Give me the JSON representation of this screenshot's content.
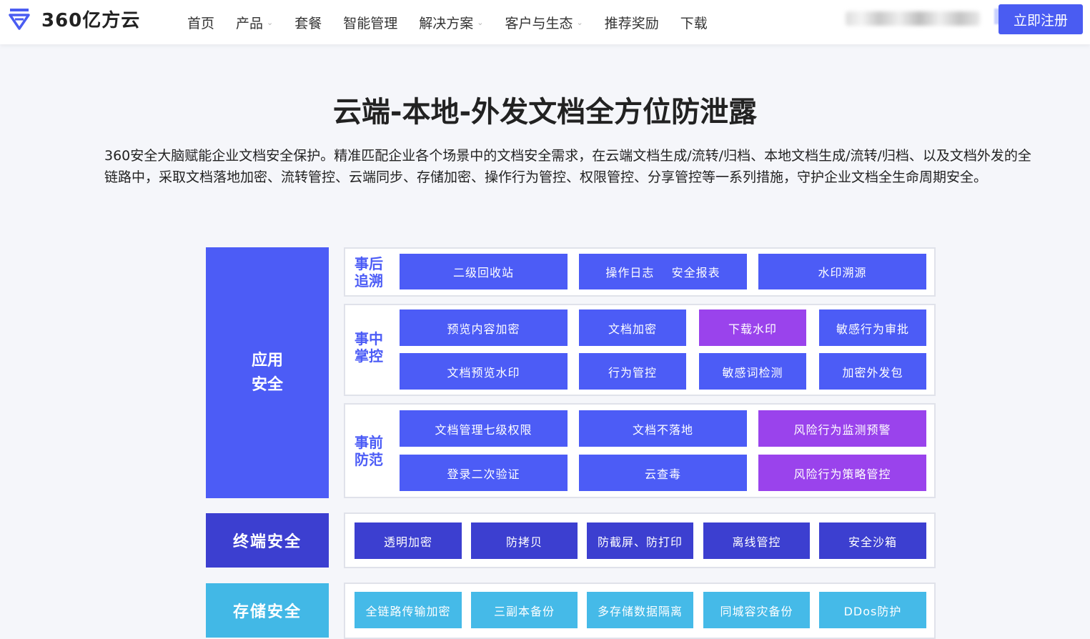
{
  "header": {
    "brand": "360亿方云",
    "nav": [
      {
        "label": "首页",
        "has_dropdown": false
      },
      {
        "label": "产品",
        "has_dropdown": true
      },
      {
        "label": "套餐",
        "has_dropdown": false
      },
      {
        "label": "智能管理",
        "has_dropdown": false
      },
      {
        "label": "解决方案",
        "has_dropdown": true
      },
      {
        "label": "客户与生态",
        "has_dropdown": true
      },
      {
        "label": "推荐奖励",
        "has_dropdown": false
      },
      {
        "label": "下载",
        "has_dropdown": false
      }
    ],
    "register_label": "立即注册"
  },
  "main": {
    "title": "云端-本地-外发文档全方位防泄露",
    "description": "360安全大脑赋能企业文档安全保护。精准匹配企业各个场景中的文档安全需求，在云端文档生成/流转/归档、本地文档生成/流转/归档、以及文档外发的全链路中，采取文档落地加密、流转管控、云端同步、存储加密、操作行为管控、权限管控、分享管控等一系列措施，守护企业文档全生命周期安全。"
  },
  "diagram": {
    "app_security": {
      "line1": "应用",
      "line2": "安全"
    },
    "terminal_security": "终端安全",
    "storage_security": "存储安全",
    "stages": {
      "after": {
        "line1": "事后",
        "line2": "追溯"
      },
      "during": {
        "line1": "事中",
        "line2": "掌控"
      },
      "before": {
        "line1": "事前",
        "line2": "防范"
      }
    },
    "after_items": [
      "二级回收站",
      "操作日志    安全报表",
      "水印溯源"
    ],
    "during_items": [
      "预览内容加密",
      "文档加密",
      "下载水印",
      "敏感行为审批",
      "文档预览水印",
      "行为管控",
      "敏感词检测",
      "加密外发包"
    ],
    "before_items": [
      "文档管理七级权限",
      "文档不落地",
      "风险行为监测预警",
      "登录二次验证",
      "云查毒",
      "风险行为策略管控"
    ],
    "terminal_items": [
      "透明加密",
      "防拷贝",
      "防截屏、防打印",
      "离线管控",
      "安全沙箱"
    ],
    "storage_items": [
      "全链路传输加密",
      "三副本备份",
      "多存储数据隔离",
      "同城容灾备份",
      "DDos防护"
    ]
  },
  "colors": {
    "primary": "#4c5cf6",
    "purple": "#9a43ec",
    "dark_blue": "#3c3fd0",
    "light_blue": "#45bae8",
    "register": "#4a5cf2"
  },
  "icons": {
    "logo": "cloud-logo-icon",
    "dropdown": "chevron-down-icon"
  }
}
